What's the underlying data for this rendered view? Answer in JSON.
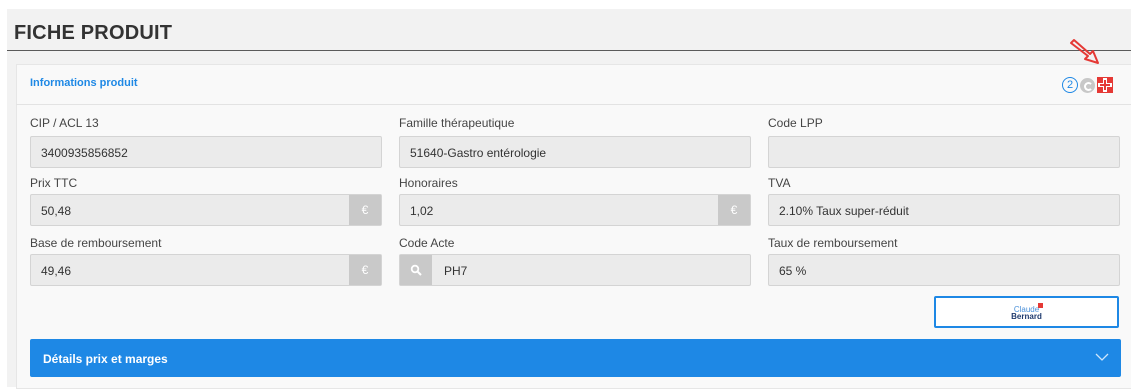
{
  "page": {
    "title": "FICHE PRODUIT"
  },
  "panel": {
    "title": "Informations produit",
    "header_icons": [
      "number-2-icon",
      "refresh-icon",
      "medical-icon"
    ],
    "badge_number": "2"
  },
  "fields": {
    "cip": {
      "label": "CIP / ACL 13",
      "value": "3400935856852"
    },
    "famille": {
      "label": "Famille thérapeutique",
      "value": "51640-Gastro entérologie"
    },
    "lpp": {
      "label": "Code LPP",
      "value": ""
    },
    "prix_ttc": {
      "label": "Prix TTC",
      "value": "50,48",
      "unit": "€"
    },
    "honoraires": {
      "label": "Honoraires",
      "value": "1,02",
      "unit": "€"
    },
    "tva": {
      "label": "TVA",
      "value": "2.10% Taux super-réduit"
    },
    "base": {
      "label": "Base de remboursement",
      "value": "49,46",
      "unit": "€"
    },
    "code_acte": {
      "label": "Code Acte",
      "value": "PH7"
    },
    "taux": {
      "label": "Taux de remboursement",
      "value": "65 %"
    }
  },
  "logo_button": {
    "line1": "Claude",
    "line2": "Bernard"
  },
  "details_bar": {
    "label": "Détails prix et marges"
  },
  "colors": {
    "accent": "#1e88e5",
    "field_bg": "#ebebeb",
    "alert": "#e53935"
  }
}
